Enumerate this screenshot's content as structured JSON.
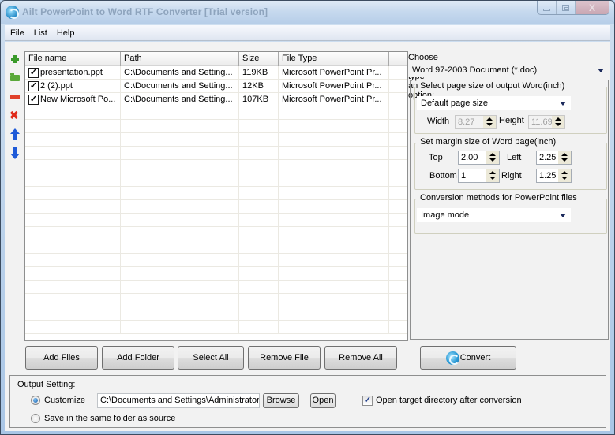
{
  "window": {
    "title": "Ailt PowerPoint to Word RTF Converter [Trial version]",
    "controls": {
      "minimize": "minimize",
      "maximize": "maximize",
      "close": "X"
    }
  },
  "menu": [
    "File",
    "List",
    "Help"
  ],
  "side_tools": [
    {
      "name": "add-file-icon"
    },
    {
      "name": "add-folder-icon"
    },
    {
      "name": "remove-icon"
    },
    {
      "name": "remove-all-icon"
    },
    {
      "name": "move-up-icon"
    },
    {
      "name": "move-down-icon"
    }
  ],
  "table": {
    "columns": [
      "File name",
      "Path",
      "Size",
      "File Type",
      ""
    ],
    "rows": [
      {
        "checked": true,
        "name": "presentation.ppt",
        "path": "C:\\Documents and Setting...",
        "size": "119KB",
        "type": "Microsoft PowerPoint Pr..."
      },
      {
        "checked": true,
        "name": "2 (2).ppt",
        "path": "C:\\Documents and Setting...",
        "size": "12KB",
        "type": "Microsoft PowerPoint Pr..."
      },
      {
        "checked": true,
        "name": "New Microsoft Po...",
        "path": "C:\\Documents and Setting...",
        "size": "107KB",
        "type": "Microsoft PowerPoint Pr..."
      }
    ]
  },
  "options": {
    "output_type_label": "Choose output type and option:",
    "output_type_value": "Word 97-2003 Document (*.doc)",
    "page_size": {
      "title": "Select page size of output Word(inch)",
      "value": "Default page size",
      "width_label": "Width",
      "width_value": "8.27",
      "height_label": "Height",
      "height_value": "11.69"
    },
    "margin": {
      "title": "Set margin size of Word page(inch)",
      "top_label": "Top",
      "top_value": "2.00",
      "left_label": "Left",
      "left_value": "2.25",
      "bottom_label": "Bottom",
      "bottom_value": "1",
      "right_label": "Right",
      "right_value": "1.25"
    },
    "conversion": {
      "title": "Conversion methods for PowerPoint files",
      "value": "Image mode"
    }
  },
  "buttons": {
    "add_files": "Add Files",
    "add_folder": "Add Folder",
    "select_all": "Select All",
    "remove_file": "Remove File",
    "remove_all": "Remove All",
    "convert": "Convert"
  },
  "output_setting": {
    "title": "Output Setting:",
    "customize_label": "Customize",
    "customize_selected": true,
    "path_value": "C:\\Documents and Settings\\Administrator\\",
    "browse": "Browse",
    "open": "Open",
    "same_folder_label": "Save in the same folder as source",
    "same_folder_selected": false,
    "open_target_label": "Open target directory after conversion",
    "open_target_checked": true
  }
}
